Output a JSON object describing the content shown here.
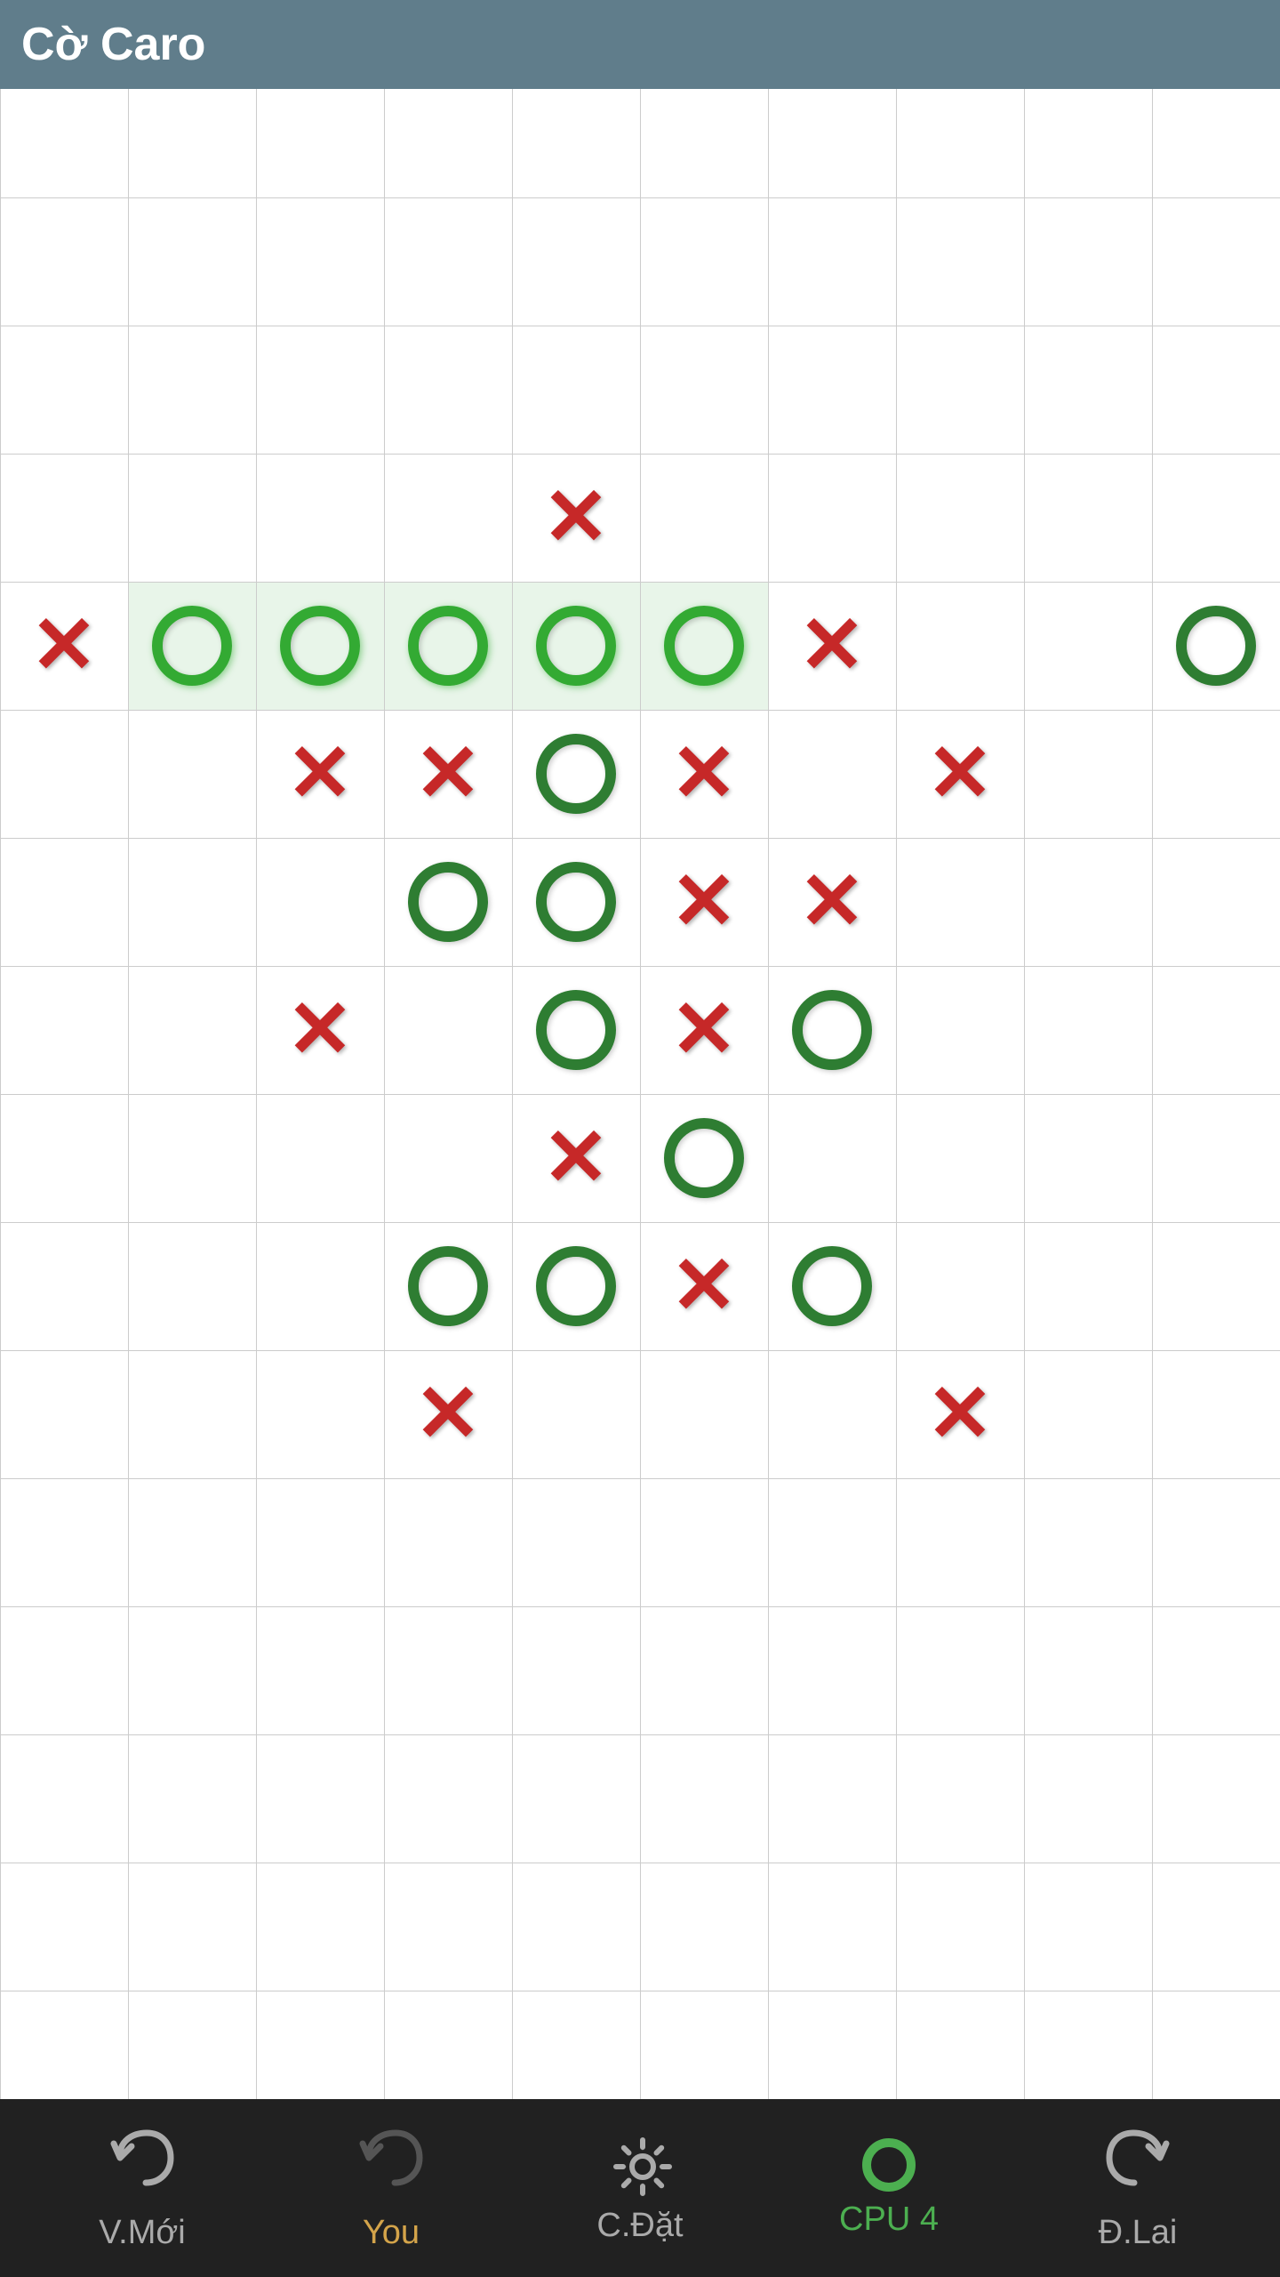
{
  "app": {
    "title": "Cờ Caro"
  },
  "board": {
    "rows": 16,
    "cols": 10,
    "cells": [
      {
        "row": 4,
        "col": 5,
        "piece": "X",
        "highlighted": false
      },
      {
        "row": 5,
        "col": 1,
        "piece": "X",
        "highlighted": false
      },
      {
        "row": 5,
        "col": 2,
        "piece": "O",
        "highlighted": true
      },
      {
        "row": 5,
        "col": 3,
        "piece": "O",
        "highlighted": true
      },
      {
        "row": 5,
        "col": 4,
        "piece": "O",
        "highlighted": true
      },
      {
        "row": 5,
        "col": 5,
        "piece": "O",
        "highlighted": true
      },
      {
        "row": 5,
        "col": 6,
        "piece": "O",
        "highlighted": true
      },
      {
        "row": 5,
        "col": 7,
        "piece": "X",
        "highlighted": false
      },
      {
        "row": 5,
        "col": 10,
        "piece": "O",
        "highlighted": false
      },
      {
        "row": 6,
        "col": 3,
        "piece": "X",
        "highlighted": false
      },
      {
        "row": 6,
        "col": 4,
        "piece": "X",
        "highlighted": false
      },
      {
        "row": 6,
        "col": 5,
        "piece": "O",
        "highlighted": false
      },
      {
        "row": 6,
        "col": 6,
        "piece": "X",
        "highlighted": false
      },
      {
        "row": 6,
        "col": 8,
        "piece": "X",
        "highlighted": false
      },
      {
        "row": 7,
        "col": 4,
        "piece": "O",
        "highlighted": false
      },
      {
        "row": 7,
        "col": 5,
        "piece": "O",
        "highlighted": false
      },
      {
        "row": 7,
        "col": 6,
        "piece": "X",
        "highlighted": false
      },
      {
        "row": 7,
        "col": 7,
        "piece": "X",
        "highlighted": false
      },
      {
        "row": 8,
        "col": 3,
        "piece": "X",
        "highlighted": false
      },
      {
        "row": 8,
        "col": 5,
        "piece": "O",
        "highlighted": false
      },
      {
        "row": 8,
        "col": 6,
        "piece": "X",
        "highlighted": false
      },
      {
        "row": 8,
        "col": 7,
        "piece": "O",
        "highlighted": false
      },
      {
        "row": 9,
        "col": 5,
        "piece": "X",
        "highlighted": false
      },
      {
        "row": 9,
        "col": 6,
        "piece": "O",
        "highlighted": false
      },
      {
        "row": 10,
        "col": 4,
        "piece": "O",
        "highlighted": false
      },
      {
        "row": 10,
        "col": 5,
        "piece": "O",
        "highlighted": false
      },
      {
        "row": 10,
        "col": 6,
        "piece": "X",
        "highlighted": false
      },
      {
        "row": 10,
        "col": 7,
        "piece": "O",
        "highlighted": false
      },
      {
        "row": 11,
        "col": 4,
        "piece": "X",
        "highlighted": false
      },
      {
        "row": 11,
        "col": 8,
        "piece": "X",
        "highlighted": false
      }
    ]
  },
  "bottomNav": {
    "items": [
      {
        "id": "new-game",
        "label": "V.Mới",
        "icon": "undo",
        "active": false
      },
      {
        "id": "you",
        "label": "You",
        "icon": "undo-gray",
        "active": true,
        "dimmed": true
      },
      {
        "id": "settings",
        "label": "C.Đặt",
        "icon": "gear",
        "active": false
      },
      {
        "id": "cpu",
        "label": "CPU 4",
        "icon": "circle",
        "active": false,
        "green": true
      },
      {
        "id": "redo",
        "label": "Đ.Lai",
        "icon": "redo",
        "active": false
      }
    ]
  }
}
